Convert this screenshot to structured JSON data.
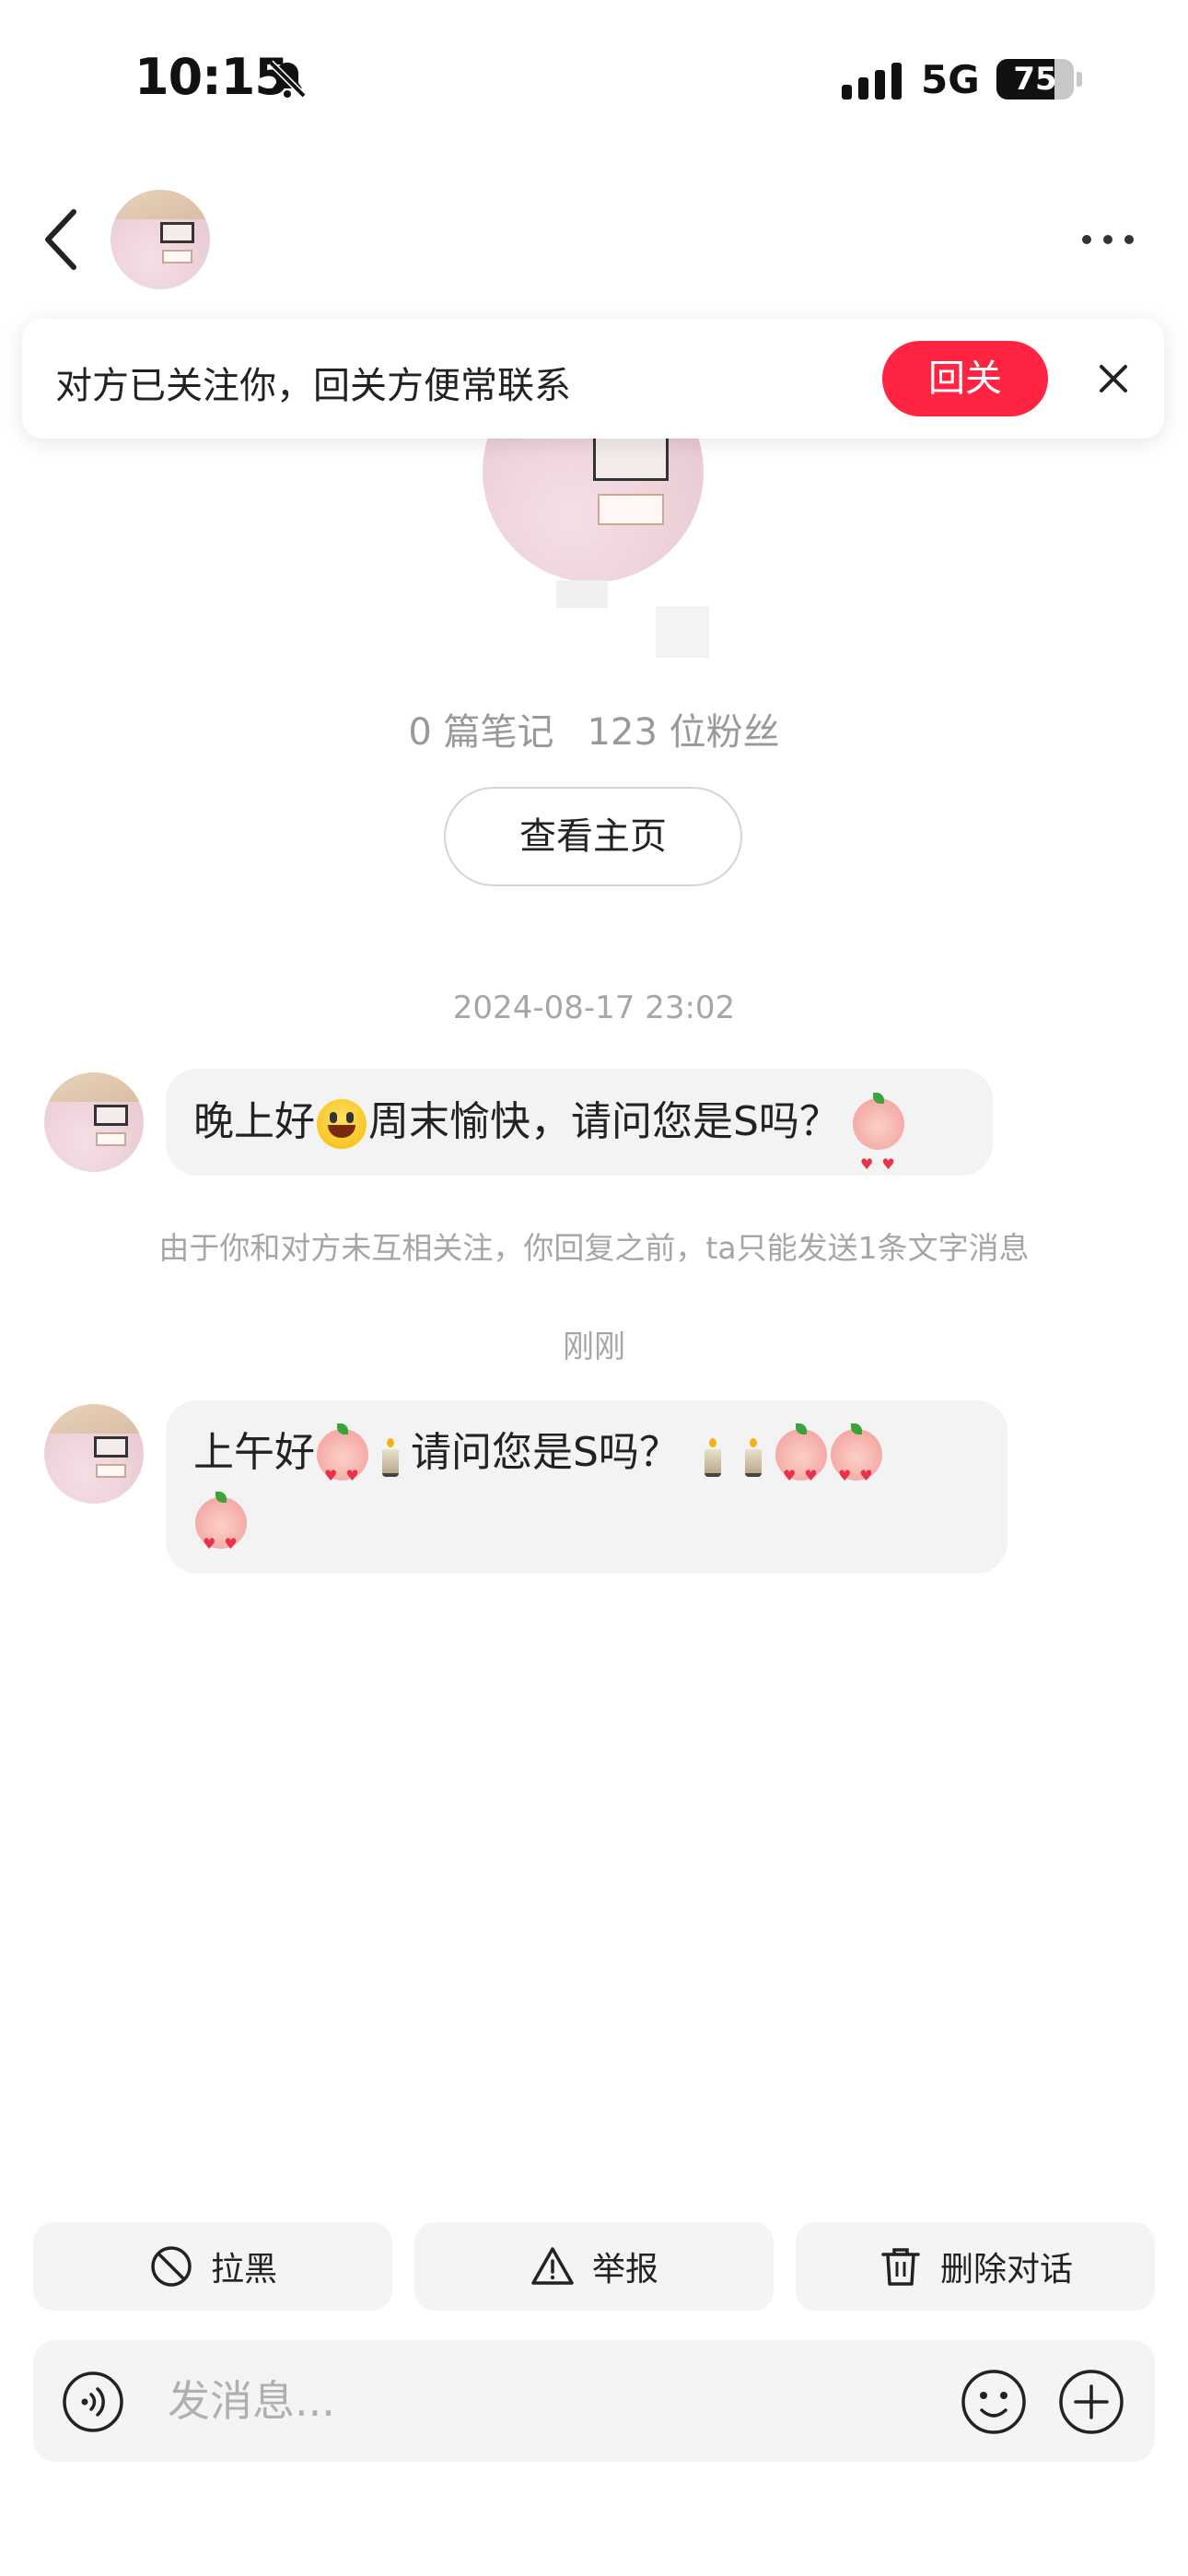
{
  "status_bar": {
    "time": "10:15",
    "network": "5G",
    "battery": "75",
    "battery_level": 0.75
  },
  "banner": {
    "text": "对方已关注你，回关方便常联系",
    "follow_back_label": "回关"
  },
  "profile": {
    "stats_notes": "0 篇笔记",
    "stats_fans": "123 位粉丝",
    "home_button_label": "查看主页"
  },
  "messages": [
    {
      "timestamp": "2024-08-17 23:02",
      "text_a": "晚上好",
      "text_b": "周末愉快，请问您是S吗？"
    },
    {
      "timestamp": "刚刚",
      "text_a": "上午好",
      "text_b": "请问您是S吗？"
    }
  ],
  "notice": "由于你和对方未互相关注，你回复之前，ta只能发送1条文字消息",
  "actions": {
    "block_label": "拉黑",
    "report_label": "举报",
    "delete_label": "删除对话"
  },
  "input": {
    "placeholder": "发消息..."
  },
  "colors": {
    "accent": "#ff2442",
    "bubble": "#f3f3f3",
    "muted_text": "#a6a6a6"
  }
}
